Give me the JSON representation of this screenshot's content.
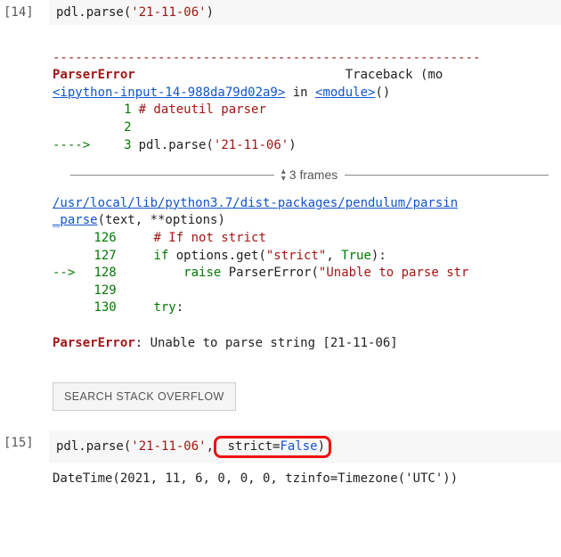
{
  "cell14": {
    "prompt": "[14]",
    "code": {
      "fn": "pdl.parse(",
      "arg": "'21-11-06'",
      "close": ")"
    }
  },
  "traceback": {
    "rule": "---------------------------------------------------------",
    "error_name": "ParserError",
    "tb_label": "Traceback (mo",
    "ipy_link": "<ipython-input-14-988da79d02a9>",
    "in_word": " in ",
    "module_link": "<module>",
    "module_close": "()",
    "src1": {
      "no": "1",
      "text": "# dateutil parser"
    },
    "src2": {
      "no": "2",
      "text": ""
    },
    "src3": {
      "arrow": "---->",
      "no": "3",
      "call_plain": "pdl.parse(",
      "call_arg": "'21-11-06'",
      "call_close": ")"
    },
    "frames_label": "3 frames",
    "file_link": "/usr/local/lib/python3.7/dist-packages/pendulum/parsin",
    "parse_fn": "_parse",
    "parse_sig": "(text, **options)",
    "l126": {
      "no": "126",
      "comment": "# If not strict"
    },
    "l127": {
      "no": "127",
      "if": "if",
      "rest1": " options.get(",
      "strict": "\"strict\"",
      "comma": ", ",
      "true": "True",
      "rest2": "):"
    },
    "l128": {
      "arrow": "-->",
      "no": "128",
      "raise": "raise",
      "call": " ParserError(",
      "msg": "\"Unable to parse str"
    },
    "l129": {
      "no": "129",
      "text": ""
    },
    "l130": {
      "no": "130",
      "try": "try",
      "colon": ":"
    },
    "final_err": "ParserError",
    "final_msg": ": Unable to parse string [21-11-06]"
  },
  "so_button": "SEARCH STACK OVERFLOW",
  "cell15": {
    "prompt": "[15]",
    "code": {
      "fn": "pdl.parse(",
      "arg": "'21-11-06'",
      "comma": ",",
      "highlight_pre": " strict=",
      "highlight_val": "False",
      "highlight_close": ")"
    },
    "output": "DateTime(2021, 11, 6, 0, 0, 0, tzinfo=Timezone('UTC'))"
  }
}
